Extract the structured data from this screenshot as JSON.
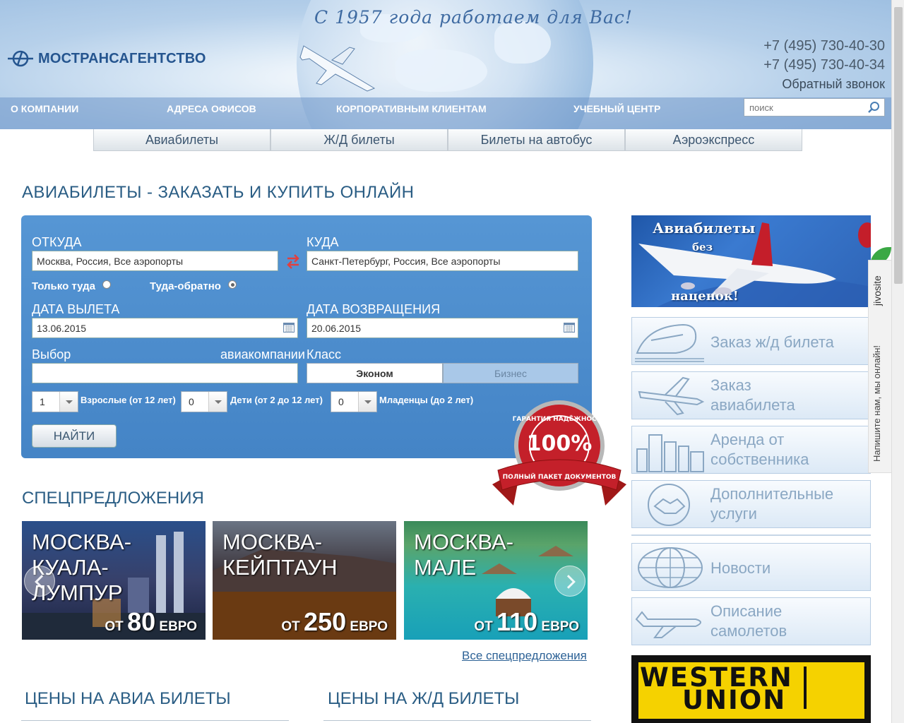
{
  "header": {
    "slogan": "С 1957 года работаем для Вас!",
    "logo_text": "МОСТРАНСАГЕНТСТВО",
    "phone1": "+7 (495) 730-40-30",
    "phone2": "+7 (495) 730-40-34",
    "callback": "Обратный звонок",
    "nav": [
      "О КОМПАНИИ",
      "АДРЕСА ОФИСОВ",
      "КОРПОРАТИВНЫМ КЛИЕНТАМ",
      "УЧЕБНЫЙ ЦЕНТР"
    ],
    "search_placeholder": "поиск"
  },
  "tabs": [
    "Авиабилеты",
    "Ж/Д билеты",
    "Билеты на автобус",
    "Аэроэкспресс"
  ],
  "page_title": "АВИАБИЛЕТЫ - ЗАКАЗАТЬ И КУПИТЬ ОНЛАЙН",
  "form": {
    "from_label": "ОТКУДА",
    "from_value": "Москва, Россия, Все аэропорты",
    "to_label": "КУДА",
    "to_value": "Санкт-Петербург, Россия, Все аэропорты",
    "one_way": "Только туда",
    "round_trip": "Туда-обратно",
    "depart_label": "ДАТА ВЫЛЕТА",
    "depart_value": "13.06.2015",
    "return_label": "ДАТА ВОЗВРАЩЕНИЯ",
    "return_value": "20.06.2015",
    "airline_label_a": "Выбор",
    "airline_label_b": "авиакомпании",
    "class_label": "Класс",
    "class_economy": "Эконом",
    "class_business": "Бизнес",
    "adults_value": "1",
    "adults_label": "Взрослые (от 12 лет)",
    "children_value": "0",
    "children_label": "Дети (от 2 до 12 лет)",
    "infants_value": "0",
    "infants_label": "Младенцы (до 2 лет)",
    "find_button": "НАЙТИ"
  },
  "seal": {
    "top_text": "ГАРАНТИЯ НАДЁЖНОСТИ",
    "percent": "100%",
    "ribbon_text": "ПОЛНЫЙ ПАКЕТ ДОКУМЕНТОВ"
  },
  "offers": {
    "title": "СПЕЦПРЕДЛОЖЕНИЯ",
    "items": [
      {
        "line1": "МОСКВА-",
        "line2": "КУАЛА-",
        "line3": "ЛУМПУР",
        "price_prefix": "ОТ ",
        "price": "80",
        "currency": " ЕВРО"
      },
      {
        "line1": "МОСКВА-",
        "line2": "КЕЙПТАУН",
        "line3": "",
        "price_prefix": "ОТ ",
        "price": "250",
        "currency": " ЕВРО"
      },
      {
        "line1": "МОСКВА-",
        "line2": "МАЛЕ",
        "line3": "",
        "price_prefix": "ОТ ",
        "price": "110",
        "currency": " ЕВРО"
      }
    ],
    "all_link": "Все спецпредложения"
  },
  "prices": {
    "air_title": "ЦЕНЫ НА АВИА БИЛЕТЫ",
    "rail_title": "ЦЕНЫ НА Ж/Д БИЛЕТЫ"
  },
  "sidebar": {
    "banner_line1": "Авиабилеты",
    "banner_line2": "без",
    "banner_line3": "наценок!",
    "items": [
      {
        "line1": "Заказ ж/д билета",
        "line2": "",
        "icon": "train-icon"
      },
      {
        "line1": "Заказ",
        "line2": "авиабилета",
        "icon": "airplane-icon"
      },
      {
        "line1": "Аренда от",
        "line2": "собственника",
        "icon": "buildings-icon"
      },
      {
        "line1": "Дополнительные",
        "line2": "услуги",
        "icon": "handshake-icon"
      },
      {
        "line1": "Новости",
        "line2": "",
        "icon": "globe-icon"
      },
      {
        "line1": "Описание",
        "line2": "самолетов",
        "icon": "jet-icon"
      }
    ],
    "wu_line1": "WESTERN",
    "wu_line2": "UNION"
  },
  "jivosite": {
    "brand": "jivosite",
    "text": "Напишите нам, мы онлайн!"
  },
  "colors": {
    "form_bg": "#4e8fd0",
    "title": "#2a5d84",
    "link": "#2d6296",
    "wu_yellow": "#f5d200"
  }
}
